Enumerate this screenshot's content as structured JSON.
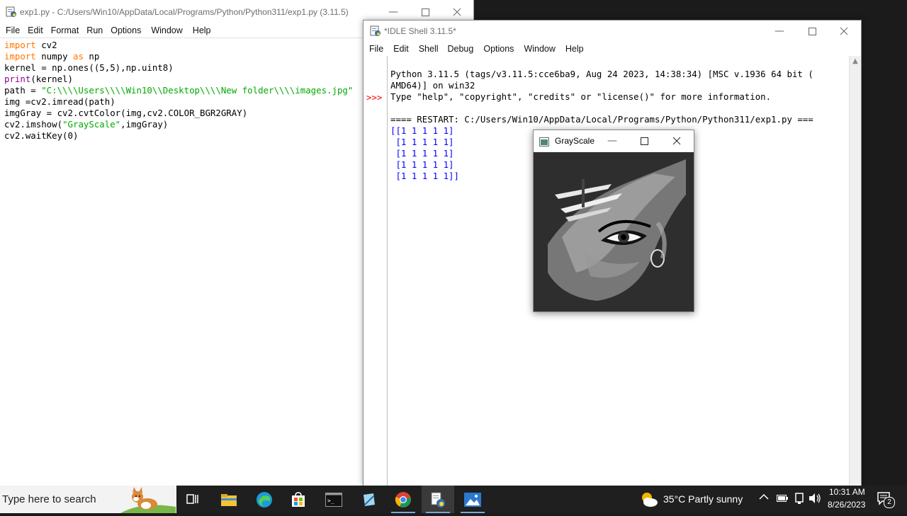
{
  "editor": {
    "title": "exp1.py - C:/Users/Win10/AppData/Local/Programs/Python/Python311/exp1.py (3.11.5)",
    "menu": [
      "File",
      "Edit",
      "Format",
      "Run",
      "Options",
      "Window",
      "Help"
    ]
  },
  "shell": {
    "title": "*IDLE Shell 3.11.5*",
    "menu": [
      "File",
      "Edit",
      "Shell",
      "Debug",
      "Options",
      "Window",
      "Help"
    ],
    "prompt": ">>>",
    "lines": [
      "Python 3.11.5 (tags/v3.11.5:cce6ba9, Aug 24 2023, 14:38:34) [MSC v.1936 64 bit (",
      "AMD64)] on win32",
      "Type \"help\", \"copyright\", \"credits\" or \"license()\" for more information.",
      "",
      "==== RESTART: C:/Users/Win10/AppData/Local/Programs/Python/Python311/exp1.py ==="
    ],
    "output": [
      "[[1 1 1 1 1]",
      " [1 1 1 1 1]",
      " [1 1 1 1 1]",
      " [1 1 1 1 1]",
      " [1 1 1 1 1]]"
    ]
  },
  "gray_window": {
    "title": "GrayScale"
  },
  "taskbar": {
    "search_placeholder": "Type here to search",
    "weather": "35°C  Partly sunny",
    "time": "10:31 AM",
    "date": "8/26/2023",
    "notification_count": "2"
  },
  "icons": {
    "editor_app": "python-idle-icon",
    "minimize": "minimize-icon",
    "maximize": "maximize-icon",
    "close": "close-icon"
  },
  "colors": {
    "keyword": "#ff7700",
    "string": "#00aa00",
    "builtin": "#900090",
    "output": "#0000ff",
    "prompt": "#ff0000"
  }
}
